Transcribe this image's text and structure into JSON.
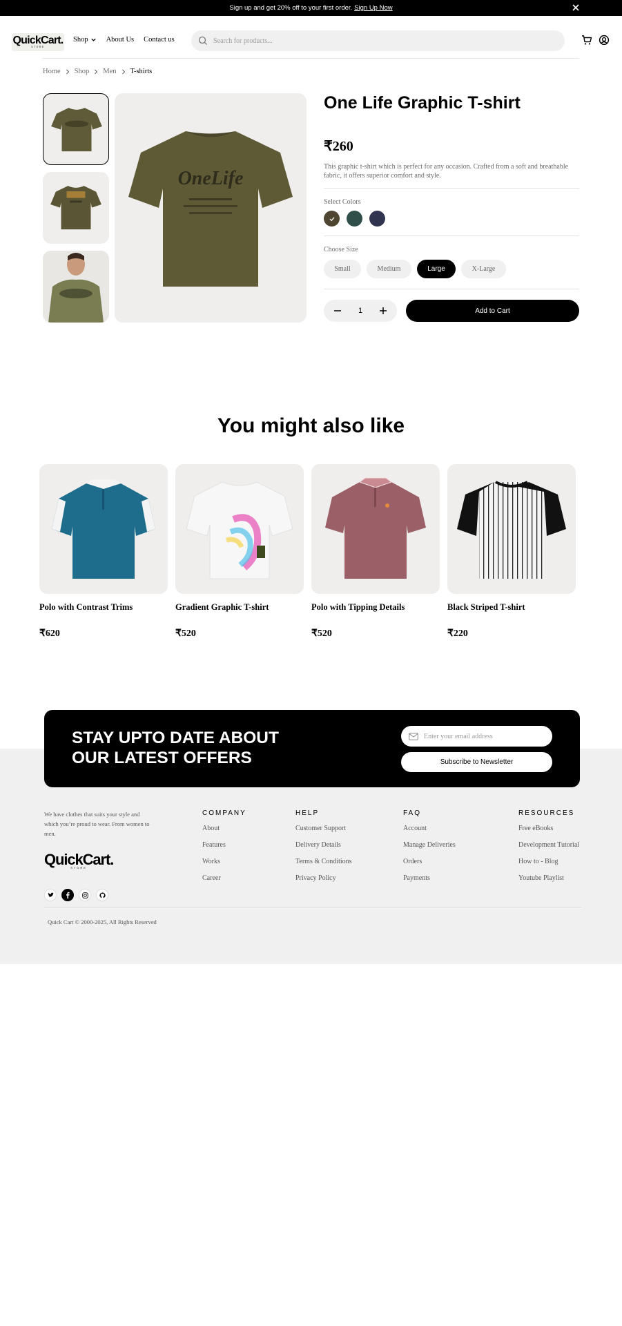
{
  "banner": {
    "text": "Sign up and get 20% off to your first order.",
    "link": "Sign Up Now"
  },
  "header": {
    "logo": "QuickCart.",
    "logo_sub": "STORE",
    "nav": [
      "Shop",
      "About Us",
      "Contact us"
    ],
    "search_placeholder": "Search for products..."
  },
  "breadcrumb": [
    "Home",
    "Shop",
    "Men",
    "T-shirts"
  ],
  "product": {
    "title": "One Life Graphic T-shirt",
    "price": "₹260",
    "description": "This graphic t-shirt which is perfect for any occasion. Crafted from a soft and breathable fabric, it offers superior comfort and style.",
    "colors_label": "Select Colors",
    "colors": [
      "#4f4631",
      "#314f4a",
      "#31344f"
    ],
    "size_label": "Choose Size",
    "sizes": [
      "Small",
      "Medium",
      "Large",
      "X-Large"
    ],
    "selected_size": "Large",
    "quantity": "1",
    "add_to_cart": "Add to Cart"
  },
  "recommendations": {
    "title": "You might also like",
    "items": [
      {
        "name": "Polo with Contrast Trims",
        "price": "₹620"
      },
      {
        "name": "Gradient Graphic T-shirt",
        "price": "₹520"
      },
      {
        "name": "Polo with Tipping Details",
        "price": "₹520"
      },
      {
        "name": "Black Striped T-shirt",
        "price": "₹220"
      }
    ]
  },
  "newsletter": {
    "line1": "STAY UPTO DATE ABOUT",
    "line2": "OUR LATEST OFFERS",
    "email_placeholder": "Enter your email address",
    "button": "Subscribe to Newsletter"
  },
  "footer": {
    "about": "We have clothes that suits your style and which you’re proud to wear. From women to men.",
    "logo": "QuickCart.",
    "logo_sub": "STORE",
    "columns": [
      {
        "title": "COMPANY",
        "items": [
          "About",
          "Features",
          "Works",
          "Career"
        ]
      },
      {
        "title": "HELP",
        "items": [
          "Customer Support",
          "Delivery Details",
          "Terms & Conditions",
          "Privacy Policy"
        ]
      },
      {
        "title": "FAQ",
        "items": [
          "Account",
          "Manage Deliveries",
          "Orders",
          "Payments"
        ]
      },
      {
        "title": "RESOURCES",
        "items": [
          "Free eBooks",
          "Development Tutorial",
          "How to - Blog",
          "Youtube Playlist"
        ]
      }
    ],
    "copyright": "Quick Cart © 2000-2025, All Rights Reserved"
  }
}
